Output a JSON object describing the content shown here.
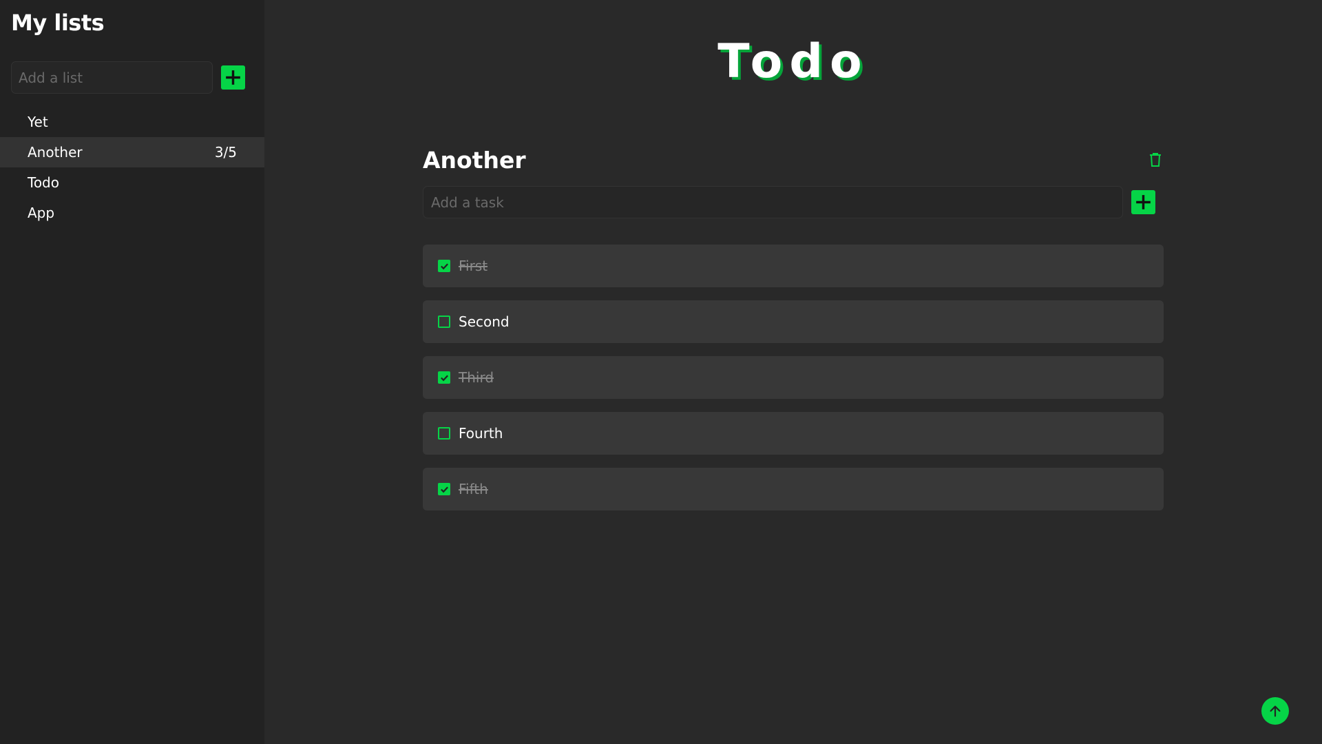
{
  "sidebar": {
    "title": "My lists",
    "add_list_placeholder": "Add a list",
    "add_icon": "plus-icon",
    "lists": [
      {
        "label": "Yet",
        "count": ""
      },
      {
        "label": "Another",
        "count": "3/5"
      },
      {
        "label": "Todo",
        "count": ""
      },
      {
        "label": "App",
        "count": ""
      }
    ],
    "active_index": 1
  },
  "main": {
    "app_title": "Todo",
    "list_title": "Another",
    "delete_icon": "trash-icon",
    "add_task_placeholder": "Add a task",
    "tasks": [
      {
        "label": "First",
        "done": true
      },
      {
        "label": "Second",
        "done": false
      },
      {
        "label": "Third",
        "done": true
      },
      {
        "label": "Fourth",
        "done": false
      },
      {
        "label": "Fifth",
        "done": true
      }
    ],
    "scroll_top_icon": "arrow-up-icon"
  },
  "colors": {
    "accent": "#06d447",
    "background": "#292929",
    "sidebar": "#222222",
    "task_bg": "#383838",
    "active_item": "#333333"
  }
}
